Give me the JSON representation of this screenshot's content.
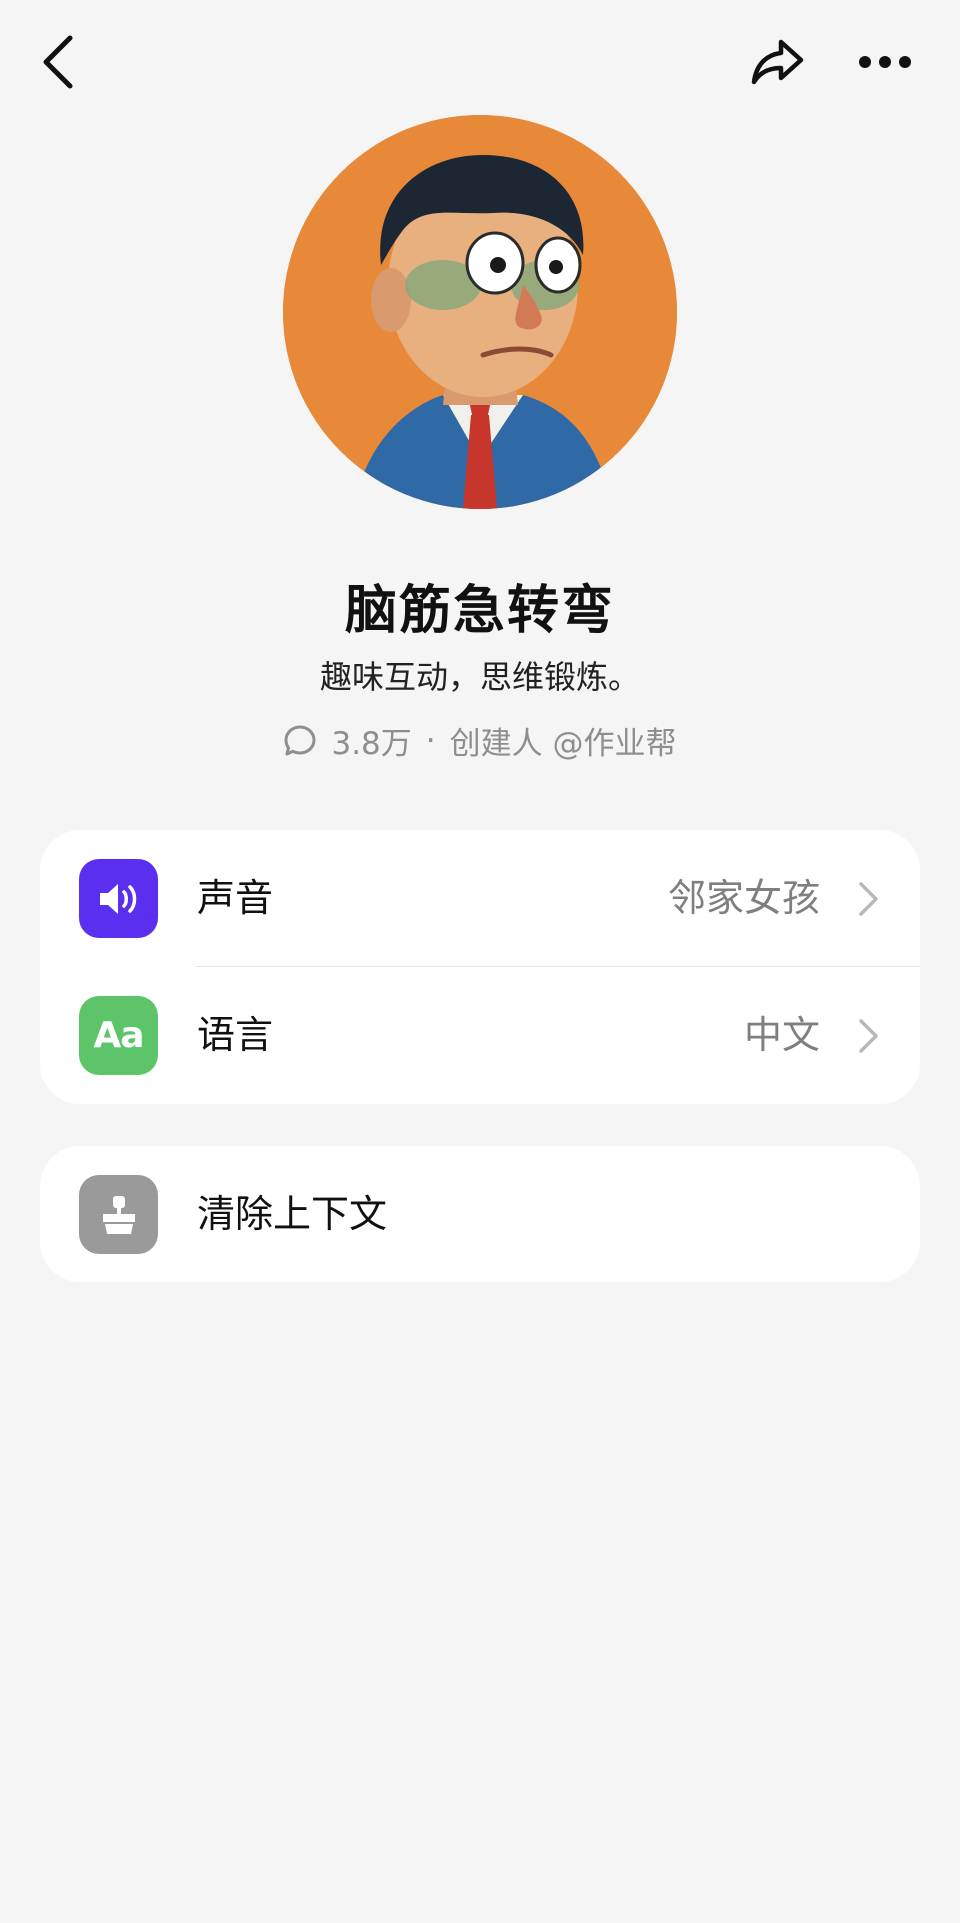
{
  "icons": {
    "back": "chevron-left-icon",
    "share": "share-icon",
    "more": "more-icon",
    "comment": "comment-bubble-icon",
    "voice": "speaker-icon",
    "language": "language-icon",
    "clear": "clear-context-icon",
    "chevron": "chevron-right-icon"
  },
  "colors": {
    "background": "#f5f5f5",
    "voice_tile": "#5b2ff0",
    "language_tile": "#5dc46a",
    "clear_tile": "#9a9a9a",
    "avatar_bg": "#e8893a"
  },
  "bot": {
    "name": "脑筋急转弯",
    "description": "趣味互动，思维锻炼。",
    "chat_count": "3.8万",
    "separator": "·",
    "creator": "创建人 @作业帮"
  },
  "settings": {
    "voice": {
      "label": "声音",
      "value": "邻家女孩"
    },
    "language": {
      "label": "语言",
      "value": "中文",
      "tile_text": "Aa"
    }
  },
  "actions": {
    "clear_context": "清除上下文"
  }
}
